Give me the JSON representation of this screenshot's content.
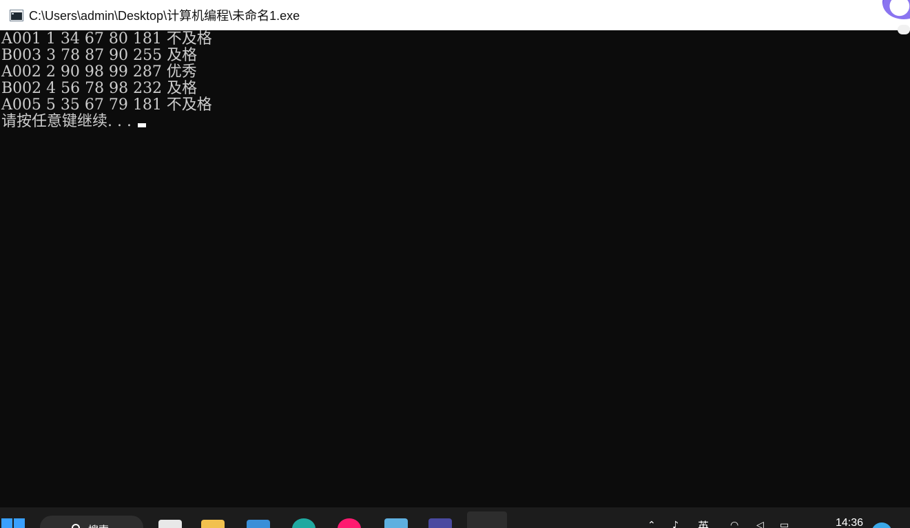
{
  "window": {
    "title": "C:\\Users\\admin\\Desktop\\计算机编程\\未命名1.exe"
  },
  "console": {
    "lines": [
      "A001 1 34 67 80 181 不及格",
      "B003 3 78 87 90 255 及格",
      "A002 2 90 98 99 287 优秀",
      "B002 4 56 78 98 232 及格",
      "A005 5 35 67 79 181 不及格"
    ],
    "prompt": "请按任意键继续. . . "
  },
  "taskbar": {
    "search_label": "搜索",
    "ime_indicator": "英",
    "clock": "14:36"
  },
  "colors": {
    "console_bg": "#0c0c0c",
    "console_text": "#cccccc",
    "titlebar_bg": "#ffffff",
    "taskbar_bg": "#1c1c1c",
    "accent": "#3aa0ff"
  },
  "icons": {
    "window": "console-window-icon",
    "start": "windows-logo-icon",
    "search": "search-icon"
  }
}
